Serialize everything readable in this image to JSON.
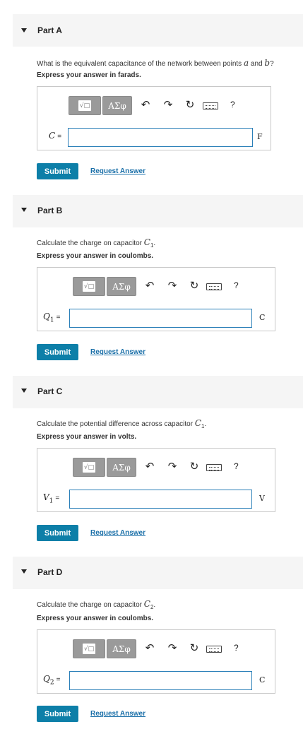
{
  "parts": [
    {
      "title": "Part A",
      "question_pre": "What is the equivalent capacitance of the network between points ",
      "q_var1": "a",
      "question_mid": " and ",
      "q_var2": "b",
      "question_post": "?",
      "instruction": "Express your answer in farads.",
      "var_symbol": "C",
      "var_sub": "",
      "equals": "=",
      "input_value": "",
      "unit": "F",
      "submit_label": "Submit",
      "request_label": "Request Answer"
    },
    {
      "title": "Part B",
      "question_pre": "Calculate the charge on capacitor ",
      "q_var1": "C",
      "q_sub1": "1",
      "question_post": ".",
      "instruction": "Express your answer in coulombs.",
      "var_symbol": "Q",
      "var_sub": "1",
      "equals": "=",
      "input_value": "",
      "unit": "C",
      "submit_label": "Submit",
      "request_label": "Request Answer"
    },
    {
      "title": "Part C",
      "question_pre": "Calculate the potential difference across capacitor ",
      "q_var1": "C",
      "q_sub1": "1",
      "question_post": ".",
      "instruction": "Express your answer in volts.",
      "var_symbol": "V",
      "var_sub": "1",
      "equals": "=",
      "input_value": "",
      "unit": "V",
      "submit_label": "Submit",
      "request_label": "Request Answer"
    },
    {
      "title": "Part D",
      "question_pre": "Calculate the charge on capacitor ",
      "q_var1": "C",
      "q_sub1": "2",
      "question_post": ".",
      "instruction": "Express your answer in coulombs.",
      "var_symbol": "Q",
      "var_sub": "2",
      "equals": "=",
      "input_value": "",
      "unit": "C",
      "submit_label": "Submit",
      "request_label": "Request Answer"
    }
  ],
  "toolbar": {
    "templates_label": "√□",
    "greek_label": "ΑΣφ",
    "undo_icon": "undo-icon",
    "redo_icon": "redo-icon",
    "reset_icon": "reset-icon",
    "keyboard_icon": "keyboard-icon",
    "help_label": "?"
  },
  "colors": {
    "submit_bg": "#0d7fa8",
    "link": "#1a6fa8",
    "header_bg": "#f5f5f5",
    "input_border": "#2a7fb8"
  }
}
